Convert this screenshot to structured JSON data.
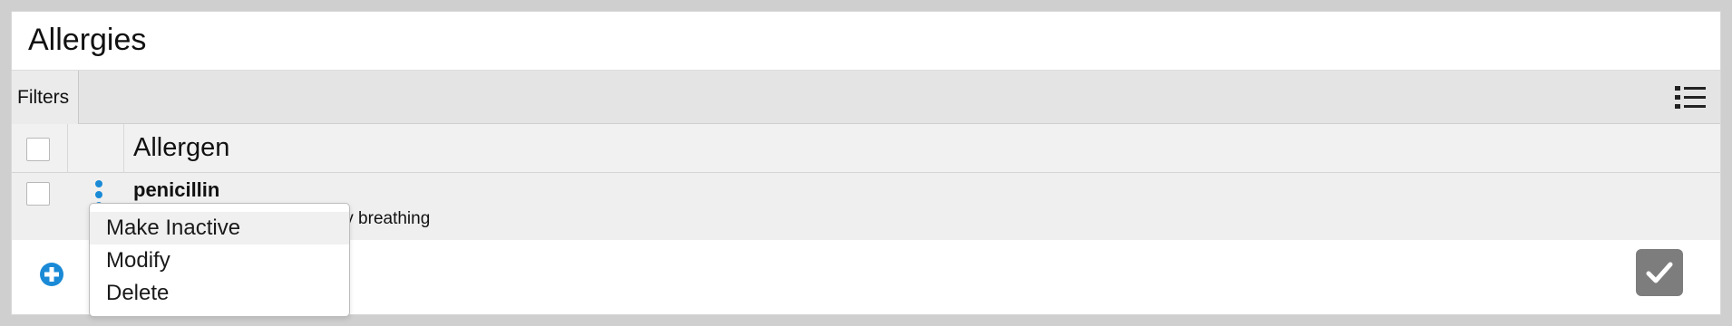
{
  "panel": {
    "title": "Allergies"
  },
  "toolbar": {
    "filters_label": "Filters",
    "list_view_icon": "list-icon"
  },
  "table": {
    "columns": [
      "Allergen"
    ],
    "rows": [
      {
        "allergen": "penicillin",
        "reaction_visible": "ty breathing",
        "menu_icon": "kebab-icon"
      }
    ]
  },
  "row_menu": {
    "items": [
      "Make Inactive",
      "Modify",
      "Delete"
    ],
    "highlighted_index": 0
  },
  "footer": {
    "add_icon": "plus-circle-icon",
    "confirm_icon": "checkmark-icon"
  },
  "colors": {
    "accent": "#1a8ad6",
    "confirm_button": "#7d7d7d",
    "background": "#cfcfcf"
  }
}
